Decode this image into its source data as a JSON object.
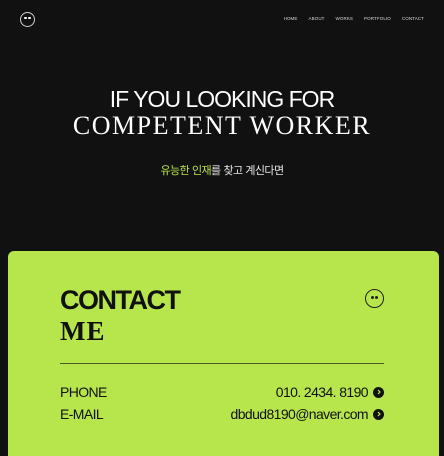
{
  "nav": {
    "items": [
      "HOME",
      "ABOUT",
      "WORKS",
      "PORTFOLIO",
      "CONTACT"
    ]
  },
  "hero": {
    "line1": "IF YOU LOOKING FOR",
    "line2": "COMPETENT WORKER",
    "sub_accent": "유능한 인재",
    "sub_rest": "를 찾고 계신다면"
  },
  "contact": {
    "title_line1": "CONTACT",
    "title_line2": "ME",
    "rows": [
      {
        "label": "PHONE",
        "value": "010. 2434. 8190"
      },
      {
        "label": "E-MAIL",
        "value": "dbdud8190@naver.com"
      }
    ]
  },
  "colors": {
    "background": "#111112",
    "accent": "#b6e64c",
    "text_dark": "#111111"
  },
  "icons": [
    "eyes-logo-icon",
    "arrow-right-circle-icon"
  ]
}
